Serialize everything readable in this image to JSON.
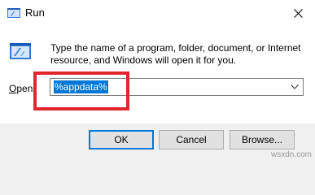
{
  "window": {
    "title": "Run",
    "app_icon": "run-icon",
    "close_icon": "close-icon"
  },
  "dialog": {
    "description": "Type the name of a program, folder, document, or Internet resource, and Windows will open it for you.",
    "open_label_prefix": "",
    "open_label_underlined": "O",
    "open_label_rest": "pen:",
    "open_value": "%appdata%",
    "dropdown_icon": "chevron-down-icon"
  },
  "buttons": {
    "ok": "OK",
    "cancel": "Cancel",
    "browse": "Browse..."
  },
  "colors": {
    "accent": "#0078d7",
    "highlight_box": "#e3262e"
  },
  "watermark": "wsxdn.com"
}
